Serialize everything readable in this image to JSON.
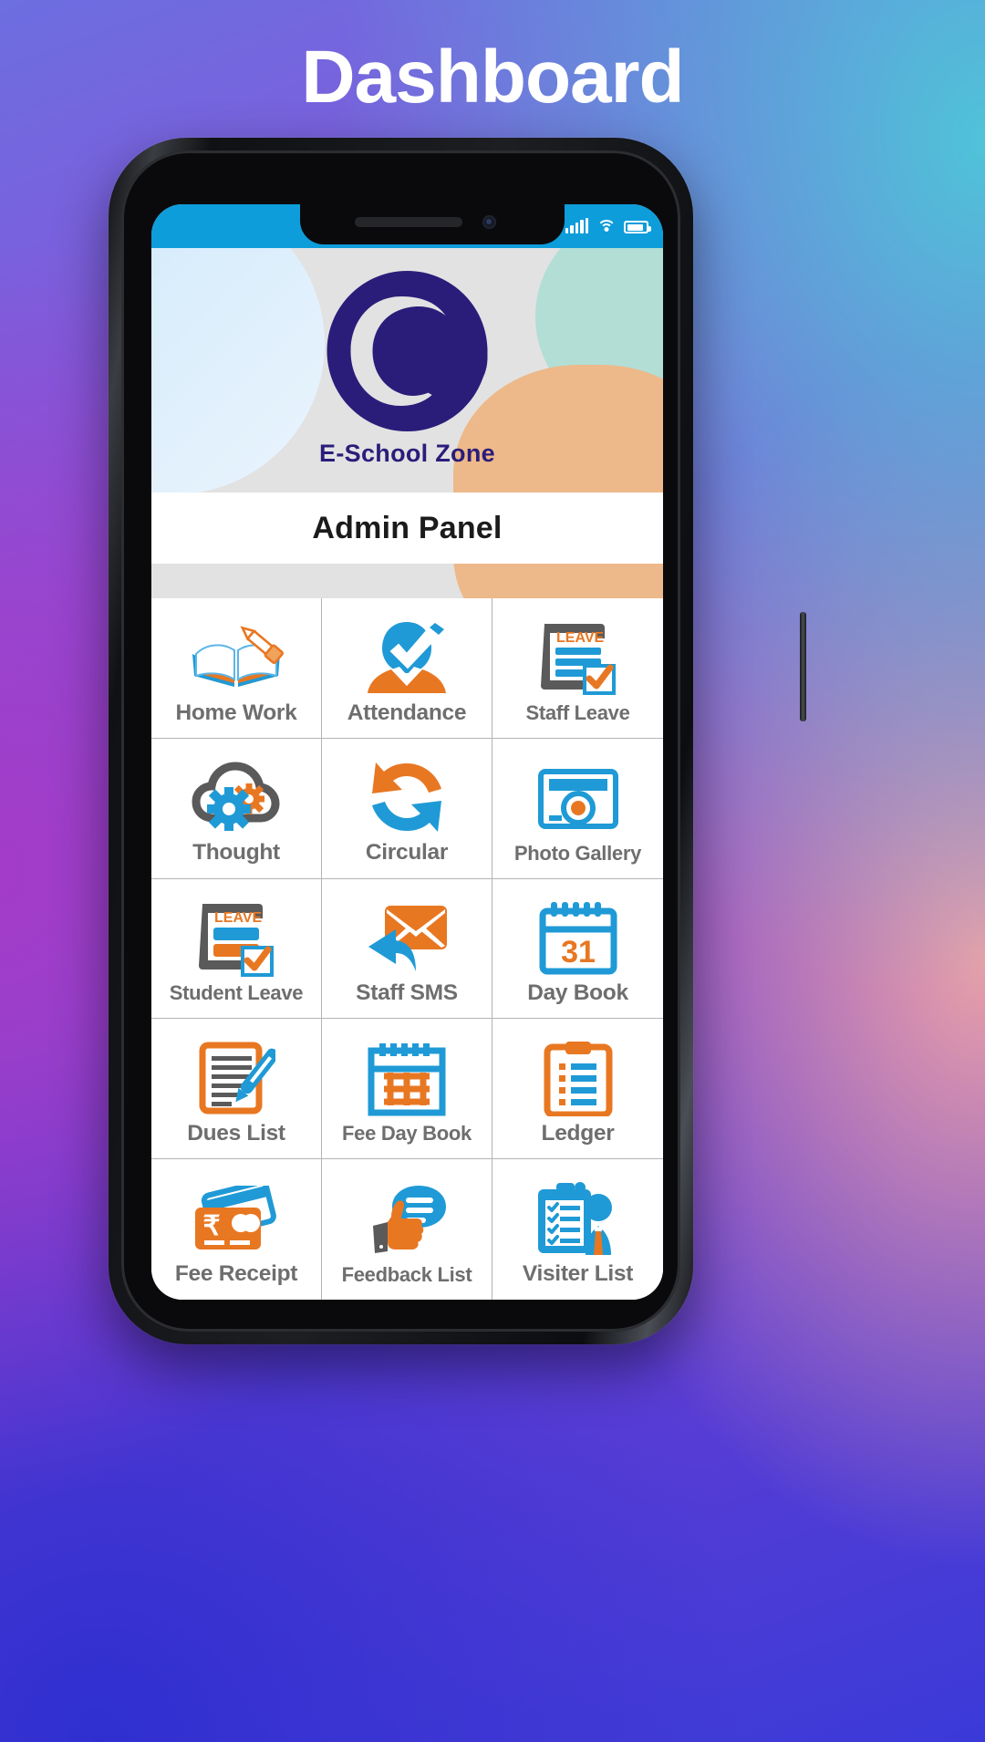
{
  "page": {
    "title": "Dashboard"
  },
  "colors": {
    "brand_blue": "#0d9ddb",
    "brand_orange": "#e87722",
    "brand_navy": "#2a1d7a",
    "label_gray": "#6e6e6e",
    "icon_gray": "#5a5a5a"
  },
  "statusbar": {
    "signal_icon": "signal-bars-icon",
    "wifi_icon": "wifi-icon",
    "battery_icon": "battery-icon"
  },
  "app_header": {
    "logo_icon": "e-school-zone-logo",
    "brand_name": "E-School Zone"
  },
  "panel": {
    "title": "Admin Panel"
  },
  "grid": {
    "items": [
      {
        "label": "Home Work",
        "icon": "book-pencil-icon"
      },
      {
        "label": "Attendance",
        "icon": "person-check-icon"
      },
      {
        "label": "Staff Leave",
        "icon": "leave-document-icon"
      },
      {
        "label": "Thought",
        "icon": "cloud-gears-icon"
      },
      {
        "label": "Circular",
        "icon": "circular-arrows-icon"
      },
      {
        "label": "Photo Gallery",
        "icon": "camera-icon"
      },
      {
        "label": "Student Leave",
        "icon": "leave-document-icon"
      },
      {
        "label": "Staff SMS",
        "icon": "envelope-reply-icon"
      },
      {
        "label": "Day Book",
        "icon": "calendar-31-icon"
      },
      {
        "label": "Dues List",
        "icon": "document-pen-icon"
      },
      {
        "label": "Fee Day Book",
        "icon": "calendar-grid-icon"
      },
      {
        "label": "Ledger",
        "icon": "clipboard-lines-icon"
      },
      {
        "label": "Fee Receipt",
        "icon": "credit-card-rupee-icon"
      },
      {
        "label": "Feedback List",
        "icon": "thumbs-up-chat-icon"
      },
      {
        "label": "Visiter List",
        "icon": "clipboard-person-icon"
      }
    ],
    "day_book_number": "31"
  }
}
